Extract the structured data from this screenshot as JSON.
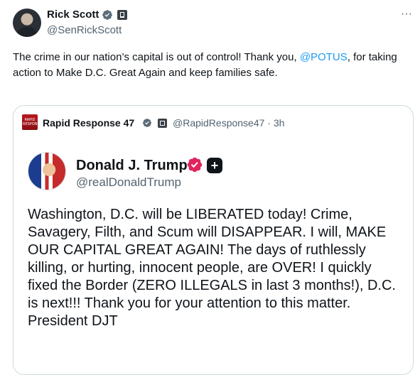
{
  "tweet": {
    "author_name": "Rick Scott",
    "author_handle": "@SenRickScott",
    "text_before": "The crime in our nation’s capital is out of control! Thank you, ",
    "mention": "@POTUS",
    "text_after": ", for taking action to Make D.C. Great Again and keep families safe.",
    "more_label": "···"
  },
  "quote": {
    "avatar_text": "RAPID RESPONSE",
    "author_name": "Rapid Response 47",
    "meta": "@RapidResponse47 · 3h",
    "inner": {
      "author_name": "Donald J. Trump",
      "author_handle": "@realDonaldTrump",
      "plus_label": "+",
      "text": "Washington, D.C. will be LIBERATED today! Crime, Savagery, Filth, and Scum will DISAPPEAR. I will, MAKE OUR CAPITAL GREAT AGAIN! The days of ruthlessly killing, or hurting, innocent people, are OVER! I quickly fixed the Border (ZERO ILLEGALS in last 3 months!), D.C. is next!!! Thank you for your attention to this matter. President DJT"
    }
  },
  "colors": {
    "link": "#1d9bf0",
    "verified_blue": "#1d9bf0",
    "verified_gold": "#e0245e",
    "gov_badge": "#394047",
    "border": "#cfd9de",
    "secondary_text": "#536471"
  },
  "icons": {
    "verified": "verified-badge-icon",
    "government": "government-affiliation-icon",
    "more": "more-options-icon",
    "plus": "plus-icon"
  }
}
